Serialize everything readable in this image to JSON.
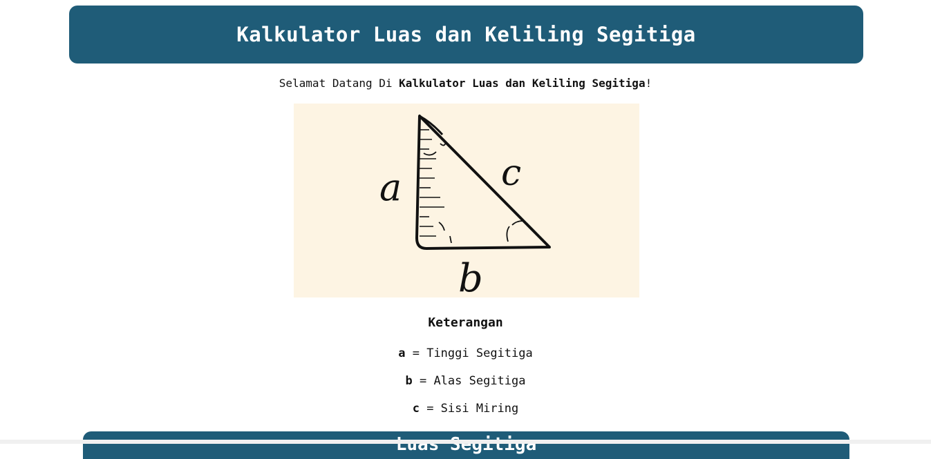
{
  "header": {
    "title": "Kalkulator Luas dan Keliling Segitiga"
  },
  "welcome": {
    "prefix": "Selamat Datang Di ",
    "bold": "Kalkulator Luas dan Keliling Segitiga",
    "suffix": "!"
  },
  "illustration": {
    "label_a": "a",
    "label_b": "b",
    "label_c": "c"
  },
  "keterangan": {
    "title": "Keterangan",
    "items": [
      {
        "key": "a",
        "desc": " = Tinggi Segitiga"
      },
      {
        "key": "b",
        "desc": " = Alas Segitiga"
      },
      {
        "key": "c",
        "desc": " = Sisi Miring"
      }
    ]
  },
  "section": {
    "title": "Luas Segitiga"
  },
  "colors": {
    "header_bg": "#1f5c78",
    "illustration_bg": "#fdf4e3"
  }
}
